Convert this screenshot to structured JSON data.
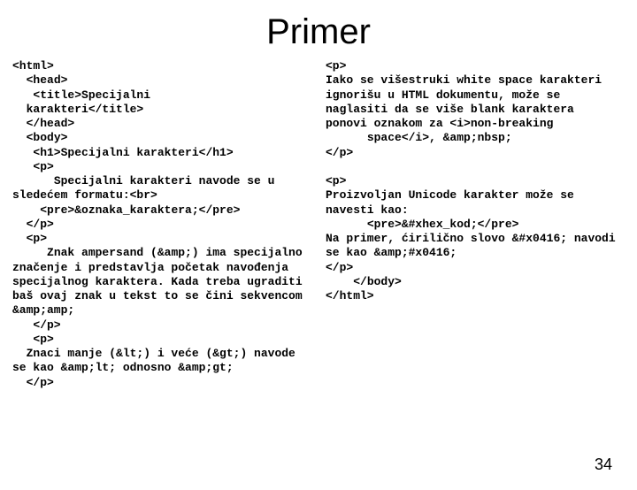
{
  "title": "Primer",
  "leftColumn": "<html>\n  <head>\n   <title>Specijalni\n  karakteri</title>\n  </head>\n  <body>\n   <h1>Specijalni karakteri</h1>\n   <p>\n      Specijalni karakteri navode se u sledećem formatu:<br>\n    <pre>&oznaka_karaktera;</pre>\n  </p>\n  <p>\n     Znak ampersand (&amp;) ima specijalno značenje i predstavlja početak navođenja specijalnog karaktera. Kada treba ugraditi baš ovaj znak u tekst to se čini sekvencom &amp;amp;\n   </p>\n   <p>\n  Znaci manje (&lt;) i veće (&gt;) navode se kao &amp;lt; odnosno &amp;gt;\n  </p>",
  "rightColumn": "<p>\nIako se višestruki white space karakteri ignorišu u HTML dokumentu, može se naglasiti da se više blank karaktera ponovi oznakom za <i>non-breaking\n      space</i>, &amp;nbsp;\n</p>\n\n<p>\nProizvoljan Unicode karakter može se navesti kao:\n      <pre>&#xhex_kod;</pre>\nNa primer, ćirilično slovo &#x0416; navodi se kao &amp;#x0416;\n</p>\n    </body>\n</html>",
  "pageNumber": "34"
}
